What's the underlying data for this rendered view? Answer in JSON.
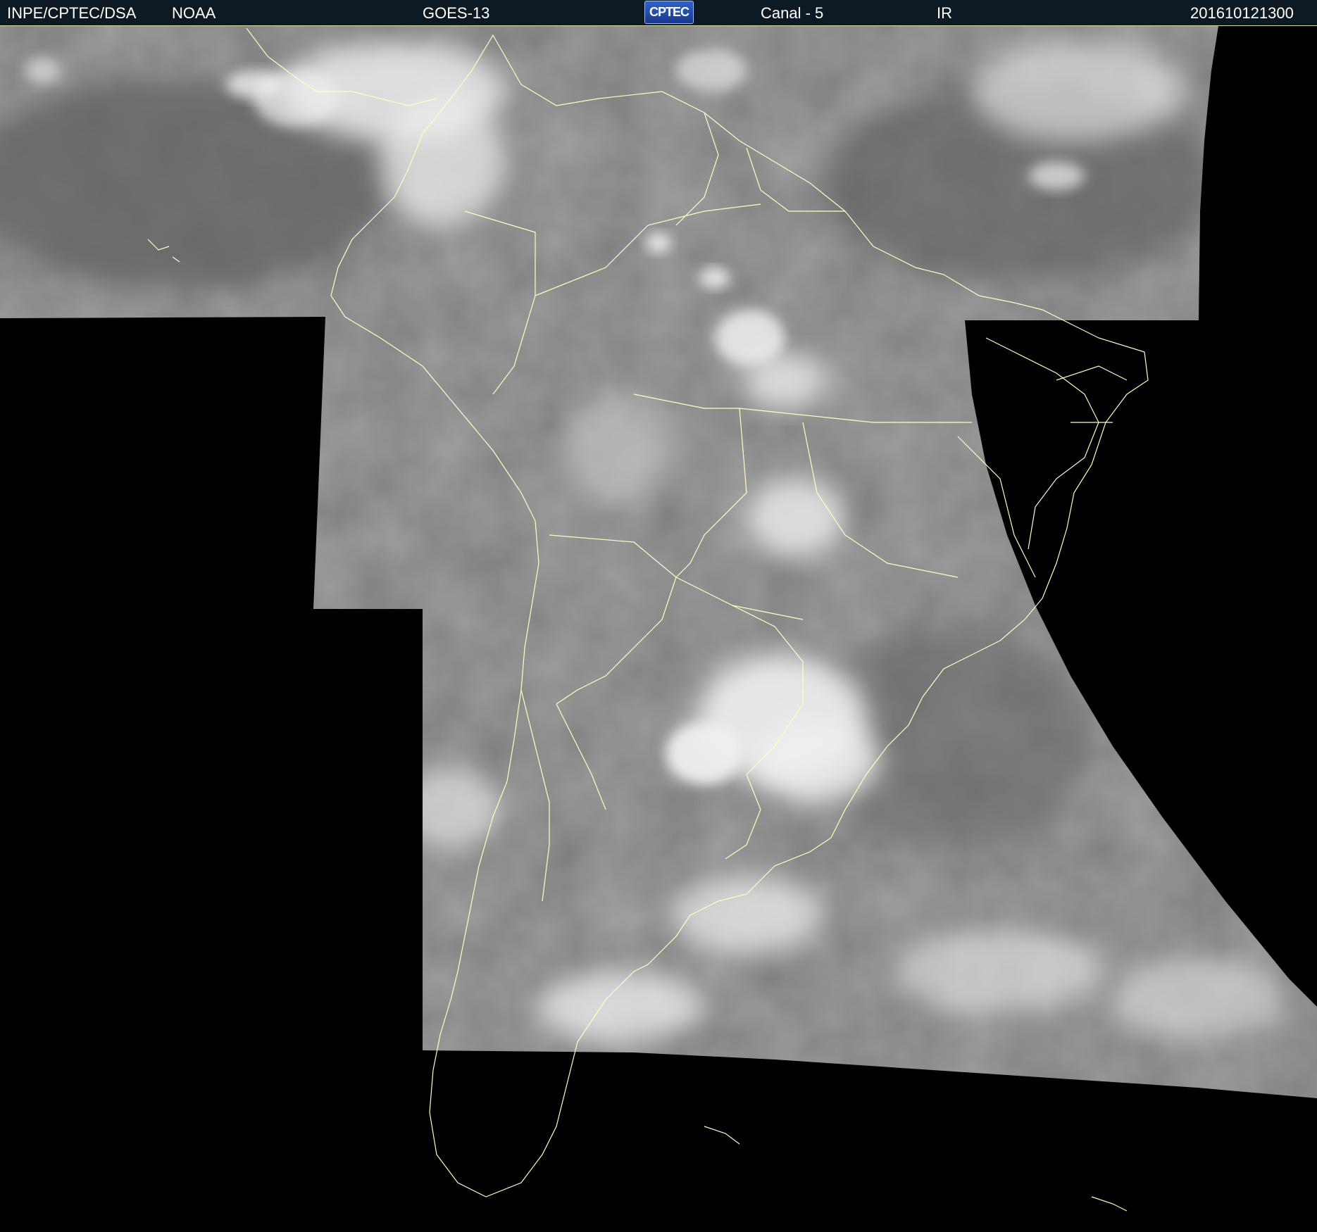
{
  "header": {
    "agency": "INPE/CPTEC/DSA",
    "operator": "NOAA",
    "satellite": "GOES-13",
    "logo_text": "CPTEC",
    "channel": "Canal - 5",
    "band": "IR",
    "timestamp": "201610121300"
  },
  "image": {
    "subject": "satellite-ir-image-south-america",
    "background_color": "#000000",
    "coverage_color": "#8a8a8a",
    "coastline_color": "#ffffc0",
    "cloud_color": "#f2f2f2"
  }
}
